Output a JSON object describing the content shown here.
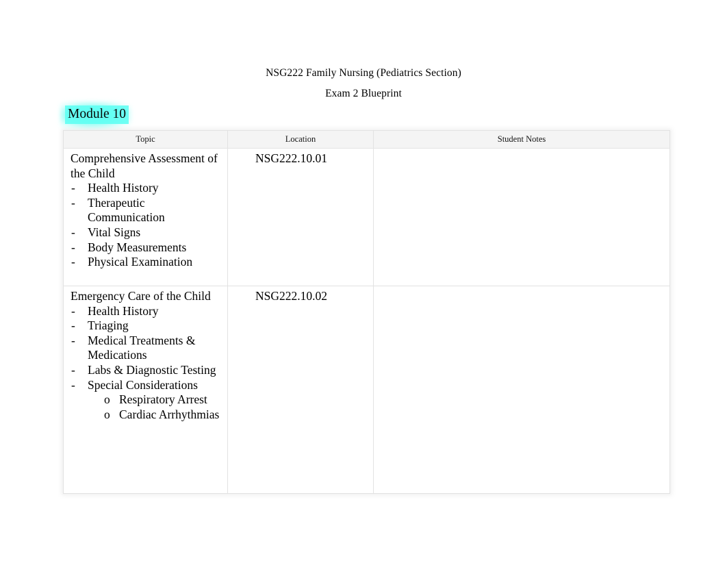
{
  "document": {
    "title_line1": "NSG222 Family Nursing (Pediatrics Section)",
    "title_line2": "Exam 2 Blueprint",
    "module_label": "Module 10",
    "highlight_color": "#5FFFF2"
  },
  "table": {
    "headers": {
      "topic": "Topic",
      "location": "Location",
      "notes": "Student Notes"
    },
    "rows": [
      {
        "heading": "Comprehensive Assessment of the Child",
        "location": "NSG222.10.01",
        "notes": "",
        "bullets": [
          {
            "marker": "-",
            "text": "Health History",
            "sub": []
          },
          {
            "marker": "-",
            "text": "Therapeutic Communication",
            "sub": []
          },
          {
            "marker": "-",
            "text": "Vital Signs",
            "sub": []
          },
          {
            "marker": "-",
            "text": "Body Measurements",
            "sub": []
          },
          {
            "marker": "-",
            "text": "Physical Examination",
            "sub": []
          }
        ]
      },
      {
        "heading": "Emergency Care of the Child",
        "location": "NSG222.10.02",
        "notes": "",
        "bullets": [
          {
            "marker": "-",
            "text": "Health History",
            "sub": []
          },
          {
            "marker": "-",
            "text": "Triaging",
            "sub": []
          },
          {
            "marker": "-",
            "text": "Medical Treatments & Medications",
            "sub": []
          },
          {
            "marker": "-",
            "text": "Labs & Diagnostic Testing",
            "sub": []
          },
          {
            "marker": "-",
            "text": "Special Considerations",
            "sub": [
              {
                "marker": "o",
                "text": "Respiratory Arrest"
              },
              {
                "marker": "o",
                "text": "Cardiac Arrhythmias"
              }
            ]
          }
        ]
      }
    ]
  }
}
